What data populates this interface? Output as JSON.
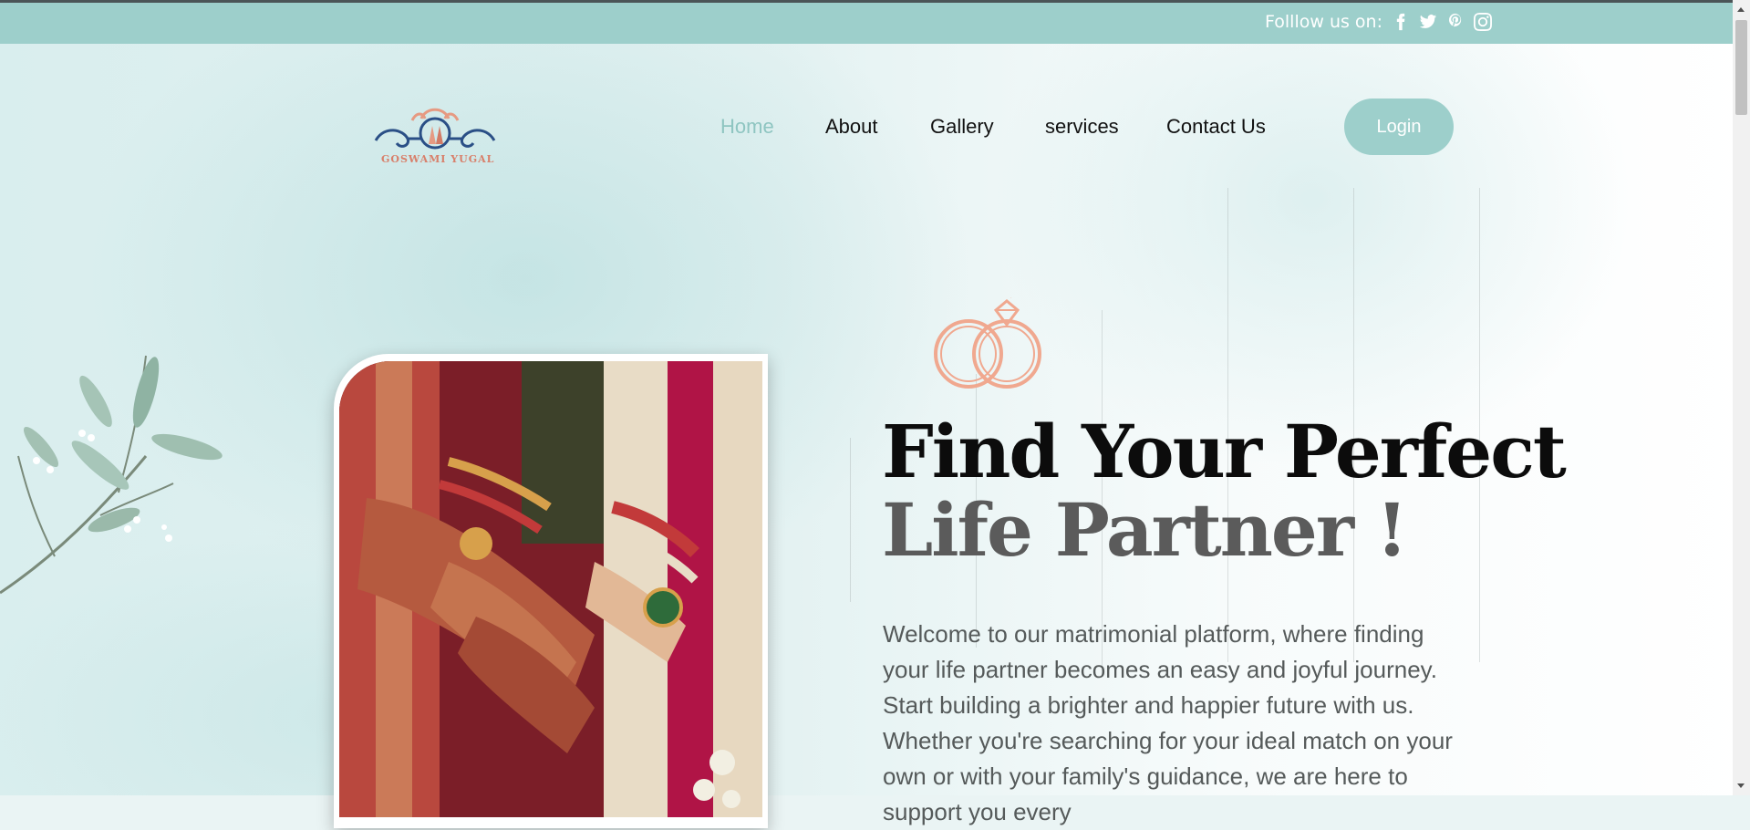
{
  "topbar": {
    "follow_label": "Folllow us on:",
    "social_icons": [
      "facebook-icon",
      "twitter-icon",
      "pinterest-icon",
      "instagram-icon"
    ]
  },
  "logo": {
    "text": "GOSWAMI YUGAL"
  },
  "nav": {
    "items": [
      {
        "label": "Home",
        "active": true
      },
      {
        "label": "About"
      },
      {
        "label": "Gallery"
      },
      {
        "label": "services"
      },
      {
        "label": "Contact Us"
      }
    ],
    "login_label": "Login"
  },
  "hero": {
    "title_line1": "Find Your Perfect",
    "title_line2": "Life Partner !",
    "paragraph": "Welcome to our matrimonial platform, where finding your life partner becomes an easy and joyful journey. Start building a brighter and happier future with us. Whether you're searching for your ideal match on your own or with your family's guidance, we are here to support you every"
  },
  "colors": {
    "accent": "#9dcfcb",
    "nav_active": "#8ec5c1",
    "title_dark": "#0c0c0c",
    "title_gray": "#5b5b5b",
    "rings": "#f0a88f"
  }
}
